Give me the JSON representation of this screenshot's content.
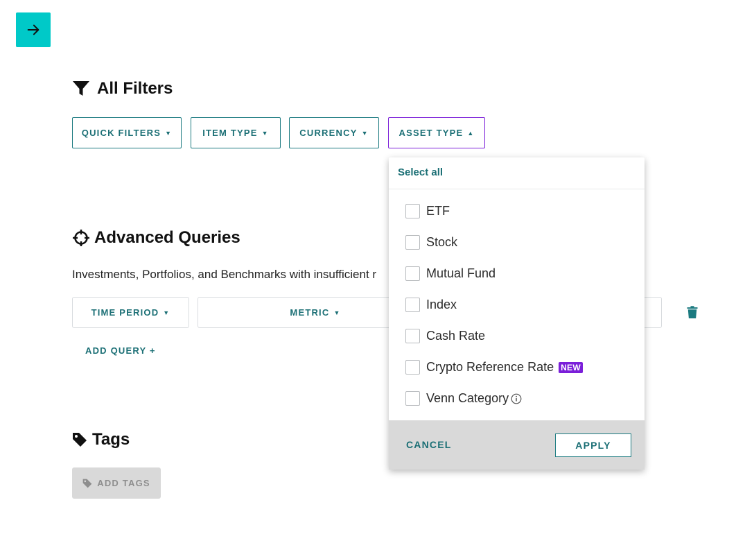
{
  "filters": {
    "title": "All Filters",
    "buttons": {
      "quick_filters": "QUICK FILTERS",
      "item_type": "ITEM TYPE",
      "currency": "CURRENCY",
      "asset_type": "ASSET TYPE"
    }
  },
  "advanced": {
    "title": "Advanced Queries",
    "description": "Investments, Portfolios, and Benchmarks with insufficient r",
    "time_period_label": "TIME PERIOD",
    "metric_label": "METRIC",
    "add_query_label": "ADD QUERY +"
  },
  "tags": {
    "title": "Tags",
    "add_tags_label": "ADD TAGS"
  },
  "dropdown": {
    "select_all": "Select all",
    "options": {
      "etf": "ETF",
      "stock": "Stock",
      "mutual_fund": "Mutual Fund",
      "index": "Index",
      "cash_rate": "Cash Rate",
      "crypto": "Crypto Reference Rate",
      "venn": "Venn Category"
    },
    "new_badge": "NEW",
    "cancel_label": "CANCEL",
    "apply_label": "APPLY"
  },
  "colors": {
    "accent_teal": "#00c9c8",
    "text_teal": "#1b6f75",
    "active_border_purple": "#7b1fd9",
    "badge_purple": "#7b1fd9"
  },
  "icons": {
    "back": "arrow-right-icon",
    "filters": "filter-icon",
    "advanced": "crosshair-icon",
    "tags": "tag-icon",
    "delete": "trash-icon",
    "info": "info-icon"
  }
}
